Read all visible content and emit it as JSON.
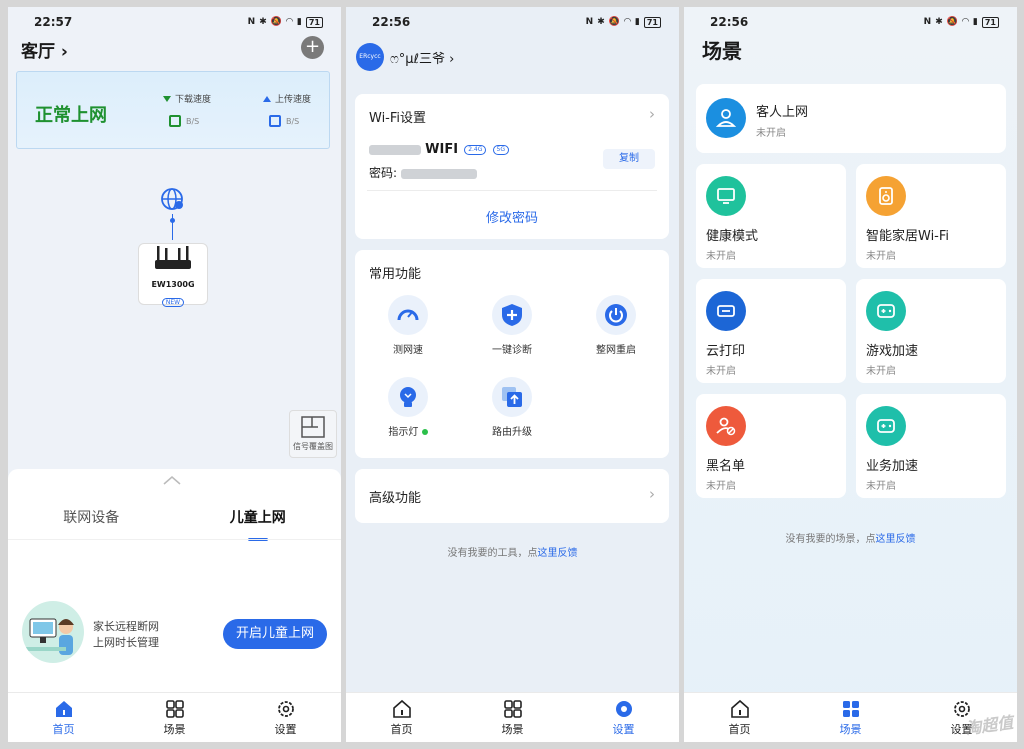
{
  "panel1": {
    "time": "22:57",
    "battery": "71",
    "room": "客厅 ›",
    "net_state": "正常上网",
    "download_label": "下载速度",
    "upload_label": "上传速度",
    "download_value": "B/S",
    "upload_value": "B/S",
    "router_model": "EW1300G",
    "new_badge": "NEW",
    "coverage_label": "信号覆盖图",
    "tabs": [
      "联网设备",
      "儿童上网"
    ],
    "kid_line1": "家长远程断网",
    "kid_line2": "上网时长管理",
    "kid_button": "开启儿童上网",
    "accent": "#2a6ae8",
    "ok_color": "#1f9130"
  },
  "panel2": {
    "time": "22:56",
    "battery": "71",
    "avatar_text": "ERcycc",
    "username": "ෆ°µℓ三爷 ›",
    "wifi_title": "Wi-Fi设置",
    "ssid_suffix": "WIFI",
    "band_24": "2.4G",
    "band_5": "5G",
    "password_label": "密码:",
    "copy": "复制",
    "change_password": "修改密码",
    "common_title": "常用功能",
    "functions": [
      "测网速",
      "一键诊断",
      "整网重启",
      "指示灯",
      "路由升级"
    ],
    "advanced": "高级功能",
    "feedback_prefix": "没有我要的工具，点",
    "feedback_link": "这里反馈"
  },
  "panel3": {
    "time": "22:56",
    "battery": "71",
    "title": "场景",
    "guest": {
      "name": "客人上网",
      "state": "未开启"
    },
    "scenes": [
      {
        "name": "健康模式",
        "state": "未开启",
        "color": "#1fc29c"
      },
      {
        "name": "智能家居Wi-Fi",
        "state": "未开启",
        "color": "#f5a233"
      },
      {
        "name": "云打印",
        "state": "未开启",
        "color": "#1c66d6"
      },
      {
        "name": "游戏加速",
        "state": "未开启",
        "color": "#1fbfaa"
      },
      {
        "name": "黑名单",
        "state": "未开启",
        "color": "#ee5a3c"
      },
      {
        "name": "业务加速",
        "state": "未开启",
        "color": "#1fbfaa"
      }
    ],
    "feedback_prefix": "没有我要的场景，点",
    "feedback_link": "这里反馈",
    "watermark": "淘超值"
  },
  "tabbar": {
    "home": "首页",
    "scene": "场景",
    "settings": "设置"
  }
}
